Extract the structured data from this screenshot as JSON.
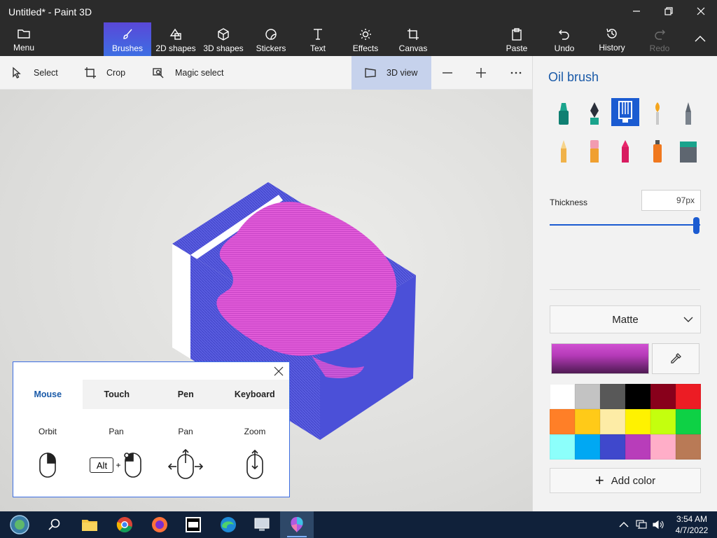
{
  "window": {
    "title": "Untitled* - Paint 3D"
  },
  "ribbon": {
    "menu": "Menu",
    "brushes": "Brushes",
    "shapes2d": "2D shapes",
    "shapes3d": "3D shapes",
    "stickers": "Stickers",
    "text": "Text",
    "effects": "Effects",
    "canvas": "Canvas",
    "paste": "Paste",
    "undo": "Undo",
    "history": "History",
    "redo": "Redo"
  },
  "toolbar": {
    "select": "Select",
    "crop": "Crop",
    "magic_select": "Magic select",
    "view3d": "3D view"
  },
  "panel": {
    "title": "Oil brush",
    "thickness_label": "Thickness",
    "thickness_value": "97px",
    "thickness_fraction": 0.97,
    "finish": "Matte",
    "add_color": "Add color",
    "current_color": "#c14ec4",
    "palette": [
      "#ffffff",
      "#c3c3c3",
      "#585858",
      "#000000",
      "#88001b",
      "#ec1c24",
      "#ff7f27",
      "#ffca18",
      "#fdeca6",
      "#fff200",
      "#c4ff0e",
      "#0ed145",
      "#8cfffb",
      "#00a8f3",
      "#3f48cc",
      "#b83dba",
      "#ffaec8",
      "#b97a56"
    ]
  },
  "help": {
    "tabs": [
      "Mouse",
      "Touch",
      "Pen",
      "Keyboard"
    ],
    "actions": [
      "Orbit",
      "Pan",
      "Pan",
      "Zoom"
    ],
    "alt_key": "Alt",
    "plus": "+"
  },
  "taskbar": {
    "time": "3:54 AM",
    "date": "4/7/2022"
  },
  "colors": {
    "accent": "#1b5bd1",
    "ribbon_bg": "#2b2b2b",
    "taskbar_bg": "#10213a"
  }
}
